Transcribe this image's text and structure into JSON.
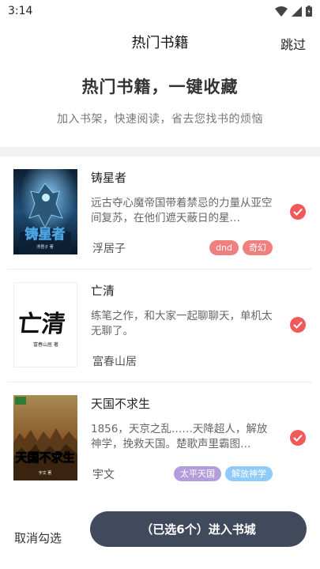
{
  "status_bar": {
    "time": "3:14"
  },
  "nav": {
    "title": "热门书籍",
    "skip_label": "跳过"
  },
  "hero": {
    "title": "热门书籍，一键收藏",
    "subtitle": "加入书架，快速阅读，省去您找书的烦恼"
  },
  "books": [
    {
      "title": "铸星者",
      "description": "远古夺心魔帝国带着禁忌的力量从亚空间复苏，在他们遮天蔽日的星…",
      "author": "浮居子",
      "tags": [
        {
          "label": "dnd",
          "color": "#f08080"
        },
        {
          "label": "奇幻",
          "color": "#f08080"
        }
      ],
      "checked": true,
      "cover": {
        "title": "铸星者",
        "author": "浮居子 著",
        "bg": "#1d3b5c",
        "icon": "warrior-figure"
      }
    },
    {
      "title": "亡清",
      "description": "练笔之作，和大家一起聊聊天，单机太无聊了。",
      "author": "富春山居",
      "tags": [],
      "checked": true,
      "cover": {
        "title": "亡清",
        "author": "富春山居 著",
        "bg": "#ffffff",
        "icon": "calligraphy"
      }
    },
    {
      "title": "天国不求生",
      "description": "1856，天京之乱……天降超人，解放神学，挽救天国。楚歌声里霸图…",
      "author": "宇文",
      "tags": [
        {
          "label": "太平天国",
          "color": "#b39ddb"
        },
        {
          "label": "解放神学",
          "color": "#90caf9"
        }
      ],
      "checked": true,
      "cover": {
        "title": "天国不求生",
        "author": "宇文 著",
        "bg": "#7a5a2a",
        "icon": "battle-scene"
      }
    }
  ],
  "bottom": {
    "cancel_label": "取消勾选",
    "enter_label": "（已选6个）进入书城"
  },
  "colors": {
    "accent": "#f25a5a",
    "button_bg": "#414a5d"
  }
}
